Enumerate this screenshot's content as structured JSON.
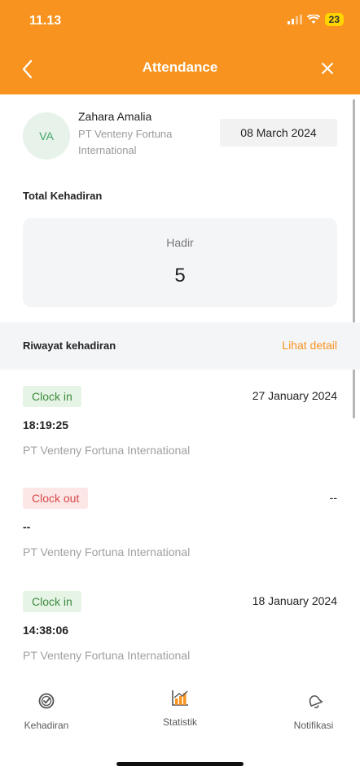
{
  "status_bar": {
    "time": "11.13",
    "battery": "23"
  },
  "nav": {
    "title": "Attendance"
  },
  "profile": {
    "initials": "VA",
    "name": "Zahara Amalia",
    "company_line1": "PT Venteny Fortuna",
    "company_line2": "International",
    "date": "08 March 2024"
  },
  "total": {
    "title": "Total Kehadiran",
    "label": "Hadir",
    "value": "5"
  },
  "riwayat": {
    "title": "Riwayat kehadiran",
    "link": "Lihat detail"
  },
  "entries": [
    {
      "type": "Clock in",
      "date": "27 January 2024",
      "time": "18:19:25",
      "company": "PT Venteny Fortuna International"
    },
    {
      "type": "Clock out",
      "date": "--",
      "time": "--",
      "company": "PT Venteny Fortuna International"
    },
    {
      "type": "Clock in",
      "date": "18 January 2024",
      "time": "14:38:06",
      "company": "PT Venteny Fortuna International"
    }
  ],
  "tabs": [
    {
      "label": "Kehadiran",
      "icon": "check-circle-icon"
    },
    {
      "label": "Statistik",
      "icon": "bar-chart-icon",
      "color": "#f7931e"
    },
    {
      "label": "Notifikasi",
      "icon": "bell-icon"
    }
  ],
  "colors": {
    "accent": "#f7931e",
    "clock_in": "#3c8a3c",
    "clock_out": "#d64848"
  }
}
